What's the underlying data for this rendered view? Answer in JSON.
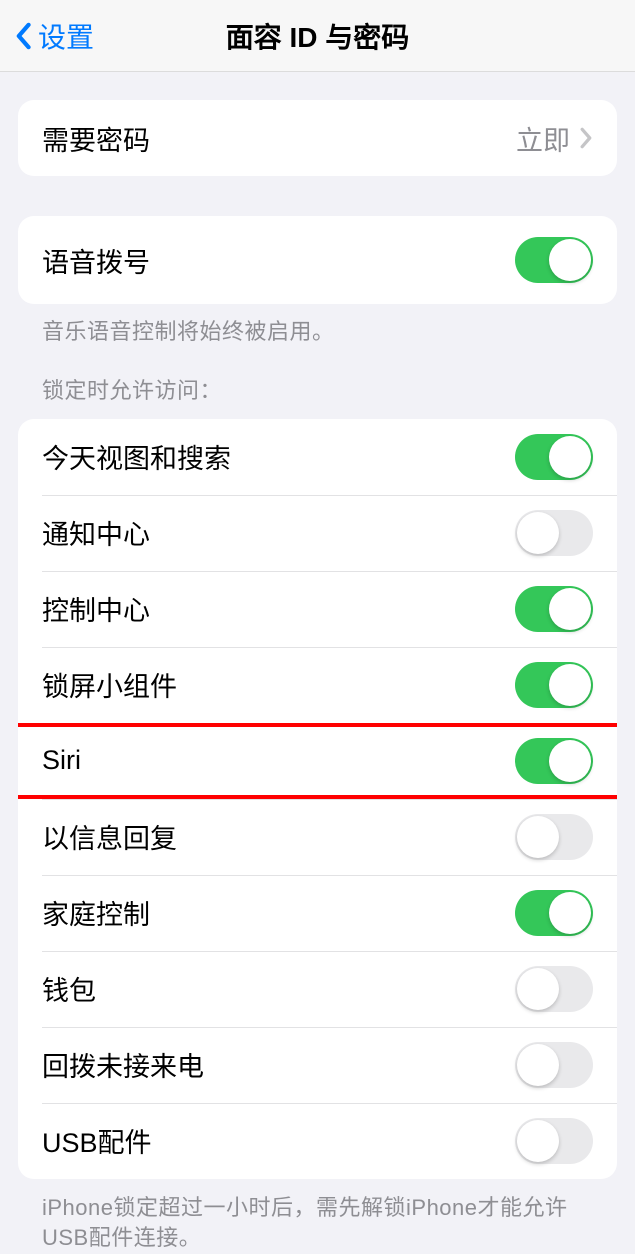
{
  "nav": {
    "back_label": "设置",
    "title": "面容 ID 与密码"
  },
  "passcode": {
    "label": "需要密码",
    "value": "立即"
  },
  "voice_dial": {
    "label": "语音拨号",
    "enabled": true,
    "footer": "音乐语音控制将始终被启用。"
  },
  "locked_access": {
    "header": "锁定时允许访问：",
    "items": [
      {
        "label": "今天视图和搜索",
        "enabled": true
      },
      {
        "label": "通知中心",
        "enabled": false
      },
      {
        "label": "控制中心",
        "enabled": true
      },
      {
        "label": "锁屏小组件",
        "enabled": true
      },
      {
        "label": "Siri",
        "enabled": true
      },
      {
        "label": "以信息回复",
        "enabled": false
      },
      {
        "label": "家庭控制",
        "enabled": true
      },
      {
        "label": "钱包",
        "enabled": false
      },
      {
        "label": "回拨未接来电",
        "enabled": false
      },
      {
        "label": "USB配件",
        "enabled": false
      }
    ],
    "footer": "iPhone锁定超过一小时后，需先解锁iPhone才能允许USB配件连接。"
  }
}
